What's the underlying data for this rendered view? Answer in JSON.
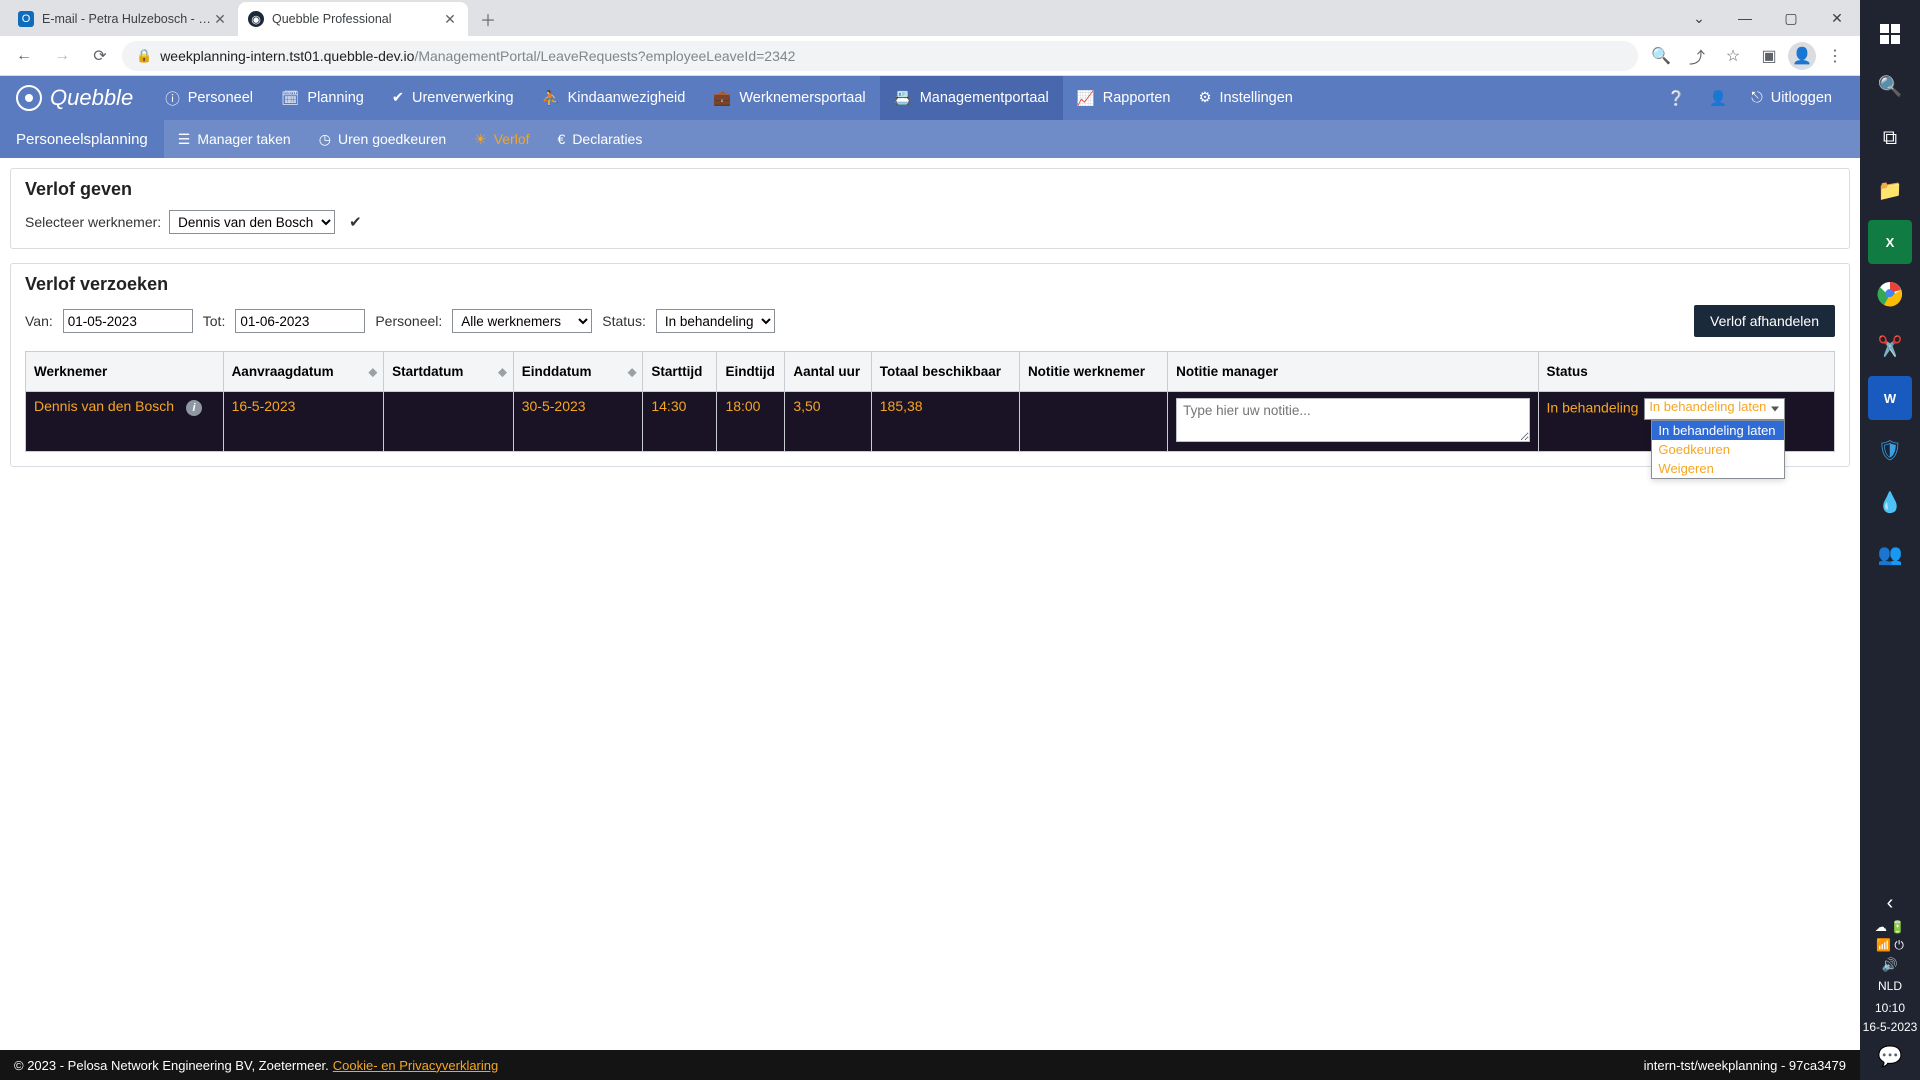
{
  "browser": {
    "tabs": [
      {
        "title": "E-mail - Petra Hulzebosch - Outl…",
        "active": false
      },
      {
        "title": "Quebble Professional",
        "active": true
      }
    ],
    "url_host": "weekplanning-intern.tst01.quebble-dev.io",
    "url_path": "/ManagementPortal/LeaveRequests?employeeLeaveId=2342"
  },
  "logo_text": "Quebble",
  "top_nav": {
    "items": [
      {
        "label": "Personeel"
      },
      {
        "label": "Planning"
      },
      {
        "label": "Urenverwerking"
      },
      {
        "label": "Kindaanwezigheid"
      },
      {
        "label": "Werknemersportaal"
      },
      {
        "label": "Managementportaal",
        "active": true
      },
      {
        "label": "Rapporten"
      },
      {
        "label": "Instellingen"
      }
    ],
    "logout": "Uitloggen"
  },
  "sub_nav": {
    "title": "Personeelsplanning",
    "items": [
      {
        "label": "Manager taken"
      },
      {
        "label": "Uren goedkeuren"
      },
      {
        "label": "Verlof",
        "active": true
      },
      {
        "label": "Declaraties"
      }
    ]
  },
  "verlof_geven": {
    "heading": "Verlof geven",
    "label": "Selecteer werknemer:",
    "selected_employee": "Dennis van den Bosch"
  },
  "verlof_verzoeken": {
    "heading": "Verlof verzoeken",
    "van_label": "Van:",
    "van_value": "01-05-2023",
    "tot_label": "Tot:",
    "tot_value": "01-06-2023",
    "personeel_label": "Personeel:",
    "personeel_value": "Alle werknemers",
    "status_label": "Status:",
    "status_value": "In behandeling",
    "button": "Verlof afhandelen",
    "columns": {
      "werknemer": "Werknemer",
      "aanvraagdatum": "Aanvraagdatum",
      "startdatum": "Startdatum",
      "einddatum": "Einddatum",
      "starttijd": "Starttijd",
      "eindtijd": "Eindtijd",
      "aantal_uur": "Aantal uur",
      "totaal_beschikbaar": "Totaal beschikbaar",
      "notitie_werknemer": "Notitie werknemer",
      "notitie_manager": "Notitie manager",
      "status": "Status"
    },
    "row": {
      "werknemer": "Dennis van den Bosch",
      "aanvraagdatum": "16-5-2023",
      "startdatum": "",
      "einddatum": "30-5-2023",
      "starttijd": "14:30",
      "eindtijd": "18:00",
      "aantal_uur": "3,50",
      "totaal_beschikbaar": "185,38",
      "notitie_werknemer": "",
      "notitie_manager_placeholder": "Type hier uw notitie...",
      "status_text": "In behandeling",
      "status_select": "In behandeling laten",
      "status_options": [
        "In behandeling laten",
        "Goedkeuren",
        "Weigeren"
      ],
      "status_highlight": "In behandeling laten"
    }
  },
  "footer": {
    "left": "© 2023 - Pelosa Network Engineering BV, Zoetermeer.",
    "link": "Cookie- en Privacyverklaring",
    "right": "intern-tst/weekplanning - 97ca3479"
  },
  "system": {
    "lang": "NLD",
    "time": "10:10",
    "date": "16-5-2023"
  }
}
